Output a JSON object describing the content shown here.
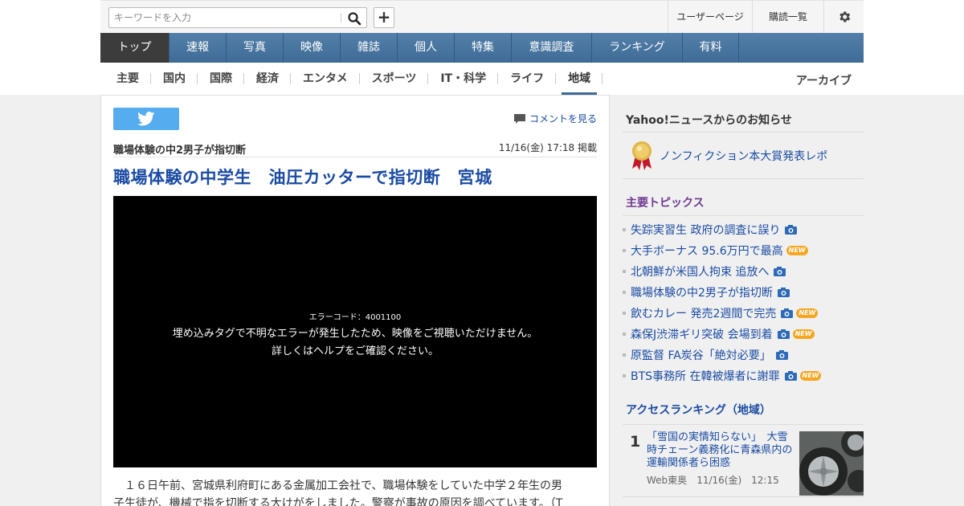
{
  "header": {
    "search_placeholder": "キーワードを入力",
    "links": [
      "ユーザーページ",
      "購読一覧"
    ]
  },
  "nav": {
    "items": [
      "トップ",
      "速報",
      "写真",
      "映像",
      "雑誌",
      "個人",
      "特集",
      "意識調査",
      "ランキング",
      "有料"
    ],
    "active": "トップ"
  },
  "subnav": {
    "items": [
      "主要",
      "国内",
      "国際",
      "経済",
      "エンタメ",
      "スポーツ",
      "IT・科学",
      "ライフ",
      "地域"
    ],
    "active": "地域",
    "archive": "アーカイブ"
  },
  "article": {
    "comment_link": "コメントを見る",
    "pickup_title": "職場体験の中2男子が指切断",
    "pubdate": "11/16(金) 17:18 掲載",
    "headline": "職場体験の中学生　油圧カッターで指切断　宮城",
    "video_error_code": "エラーコード：4001100",
    "video_error_line1": "埋め込みタグで不明なエラーが発生したため、映像をご視聴いただけません。",
    "video_error_line2": "詳しくはヘルプをご確認ください。",
    "body_line1": "　１６日午前、宮城県利府町にある金属加工会社で、職場体験をしていた中学２年生の男",
    "body_line2": "子生徒が、機械で指を切断する大けがをしました。警察が事故の原因を調べています。（T"
  },
  "sidebar": {
    "notice_title": "Yahoo!ニュースからのお知らせ",
    "notice_link": "ノンフィクション本大賞発表レポ",
    "topics_title": "主要トピックス",
    "topics": [
      {
        "text": "失踪実習生 政府の調査に誤り",
        "photo": true,
        "new": false
      },
      {
        "text": "大手ボーナス 95.6万円で最高",
        "photo": false,
        "new": true
      },
      {
        "text": "北朝鮮が米国人拘束 追放へ",
        "photo": true,
        "new": false
      },
      {
        "text": "職場体験の中2男子が指切断",
        "photo": true,
        "new": false
      },
      {
        "text": "飲むカレー 発売2週間で完売",
        "photo": true,
        "new": true
      },
      {
        "text": "森保J渋滞ギリ突破 会場到着",
        "photo": true,
        "new": true
      },
      {
        "text": "原監督 FA炭谷「絶対必要」",
        "photo": true,
        "new": false
      },
      {
        "text": "BTS事務所 在韓被爆者に謝罪",
        "photo": true,
        "new": true
      }
    ],
    "new_label": "NEW",
    "ranking_title": "アクセスランキング（地域）",
    "ranking": [
      {
        "rank": "1",
        "title": "「雪国の実情知らない」　大雪時チェーン義務化に青森県内の運輸関係者ら困惑",
        "source": "Web東奥",
        "date": "11/16(金)　12:15"
      }
    ]
  },
  "colors": {
    "nav_blue": "#3f6c97",
    "link_blue": "#1a4ba3",
    "topics_purple": "#6f3a91",
    "twitter": "#55acee",
    "new_badge": "#f5a623"
  }
}
